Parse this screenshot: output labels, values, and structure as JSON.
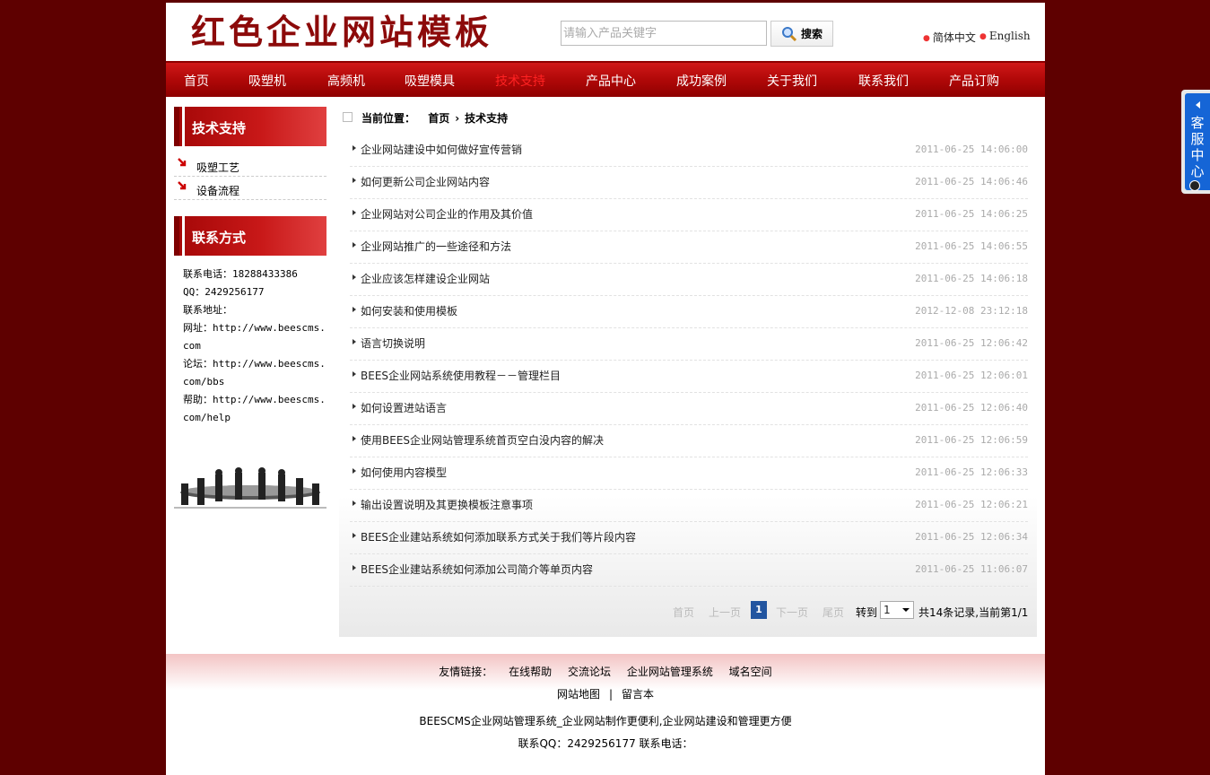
{
  "header": {
    "logo": "红色企业网站模板",
    "search_placeholder": "请输入产品关键字",
    "search_button": "搜索",
    "lang_cn": "简体中文",
    "lang_en": "English"
  },
  "nav": [
    "首页",
    "吸塑机",
    "高频机",
    "吸塑模具",
    "技术支持",
    "产品中心",
    "成功案例",
    "关于我们",
    "联系我们",
    "产品订购"
  ],
  "nav_active": "技术支持",
  "sidebar": {
    "section_title": "技术支持",
    "items": [
      "吸塑工艺",
      "设备流程"
    ],
    "contact_title": "联系方式",
    "contact_lines": [
      "联系电话：18288433386",
      "QQ：2429256177",
      "联系地址：",
      "网址：http://www.beescms.com",
      "论坛：http://www.beescms.com/bbs",
      "帮助：http://www.beescms.com/help"
    ]
  },
  "breadcrumb": {
    "label": "当前位置：",
    "home": "首页",
    "current": "技术支持"
  },
  "articles": [
    {
      "title": "企业网站建设中如何做好宣传营销",
      "date": "2011-06-25 14:06:00"
    },
    {
      "title": "如何更新公司企业网站内容",
      "date": "2011-06-25 14:06:46"
    },
    {
      "title": "企业网站对公司企业的作用及其价值",
      "date": "2011-06-25 14:06:25"
    },
    {
      "title": "企业网站推广的一些途径和方法",
      "date": "2011-06-25 14:06:55"
    },
    {
      "title": "企业应该怎样建设企业网站",
      "date": "2011-06-25 14:06:18"
    },
    {
      "title": "如何安装和使用模板",
      "date": "2012-12-08 23:12:18"
    },
    {
      "title": "语言切换说明",
      "date": "2011-06-25 12:06:42"
    },
    {
      "title": "BEES企业网站系统使用教程－－管理栏目",
      "date": "2011-06-25 12:06:01"
    },
    {
      "title": "如何设置进站语言",
      "date": "2011-06-25 12:06:40"
    },
    {
      "title": "使用BEES企业网站管理系统首页空白没内容的解决",
      "date": "2011-06-25 12:06:59"
    },
    {
      "title": "如何使用内容模型",
      "date": "2011-06-25 12:06:33"
    },
    {
      "title": "输出设置说明及其更换模板注意事项",
      "date": "2011-06-25 12:06:21"
    },
    {
      "title": "BEES企业建站系统如何添加联系方式关于我们等片段内容",
      "date": "2011-06-25 12:06:34"
    },
    {
      "title": "BEES企业建站系统如何添加公司简介等单页内容",
      "date": "2011-06-25 11:06:07"
    }
  ],
  "pager": {
    "first": "首页",
    "prev": "上一页",
    "current": "1",
    "next": "下一页",
    "last": "尾页",
    "goto_label": "转到",
    "goto_value": "1",
    "info": "共14条记录,当前第1/1"
  },
  "footer": {
    "links_label": "友情链接：",
    "links": [
      "在线帮助",
      "交流论坛",
      "企业网站管理系统",
      "域名空间"
    ],
    "sitemap": "网站地图",
    "separator": "|",
    "guestbook": "留言本",
    "slogan": "BEESCMS企业网站管理系统_企业网站制作更便利,企业网站建设和管理更方便",
    "contact": "联系QQ：2429256177 联系电话："
  },
  "float_service": {
    "label": "客服中心"
  },
  "colors": {
    "background": "#5e0000",
    "nav": "#b00808",
    "accent": "#8c0a0a",
    "pager_current": "#2255a0"
  }
}
